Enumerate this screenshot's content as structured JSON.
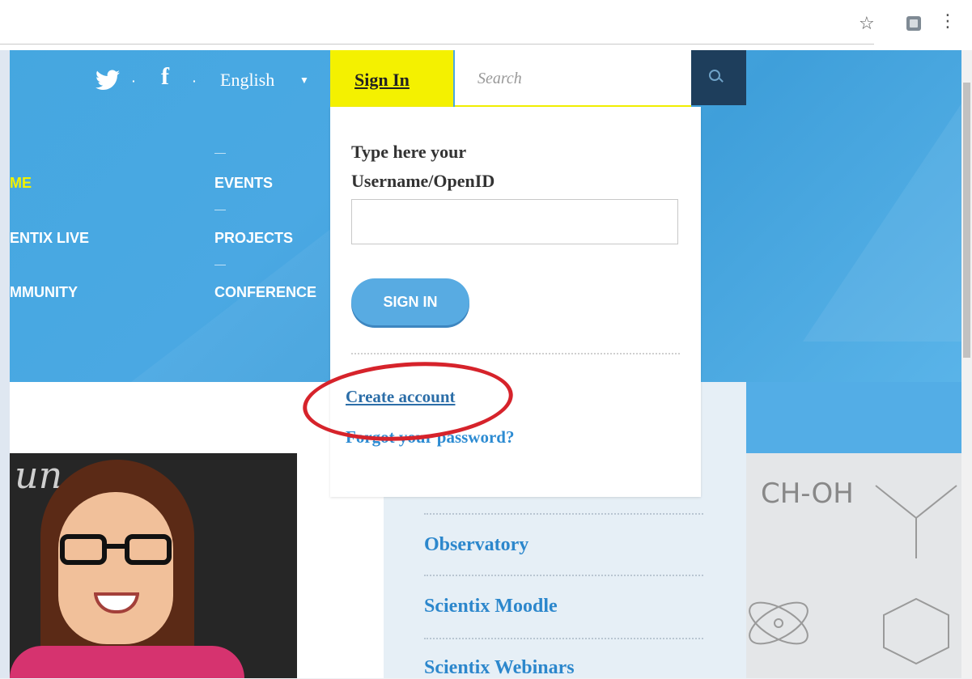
{
  "browser": {
    "bookmark_icon": "star-icon",
    "extension_icon": "extension-icon",
    "menu_icon": "kebab-menu-icon"
  },
  "header": {
    "social": {
      "twitter_icon": "twitter-icon",
      "facebook_icon": "facebook-icon",
      "separator": "·"
    },
    "language": "English",
    "signin_tab": "Sign In",
    "search_placeholder": "Search",
    "search_icon": "search-icon",
    "nav": [
      {
        "label": "ME",
        "active": true
      },
      {
        "label": "ENTIX LIVE"
      },
      {
        "label": "MMUNITY"
      },
      {
        "label": "EVENTS"
      },
      {
        "label": "PROJECTS"
      },
      {
        "label": "CONFERENCE"
      }
    ],
    "colors": {
      "blue": "#4aa8e3",
      "yellow": "#f4f100",
      "dark_blue": "#1e3e5c"
    }
  },
  "signin_panel": {
    "prompt_line1": "Type here your",
    "prompt_line2": "Username/OpenID",
    "username_value": "",
    "signin_button": "SIGN IN",
    "create_account": "Create account",
    "forgot_password": "Forgot your password?",
    "highlight_color": "#d6232b"
  },
  "photo": {
    "chalk_text": "un",
    "alt": "smiling woman with glasses"
  },
  "sidebar": {
    "links": [
      "Observatory",
      "Scientix Moodle",
      "Scientix Webinars"
    ]
  },
  "background": {
    "formula": "CH-OH"
  }
}
